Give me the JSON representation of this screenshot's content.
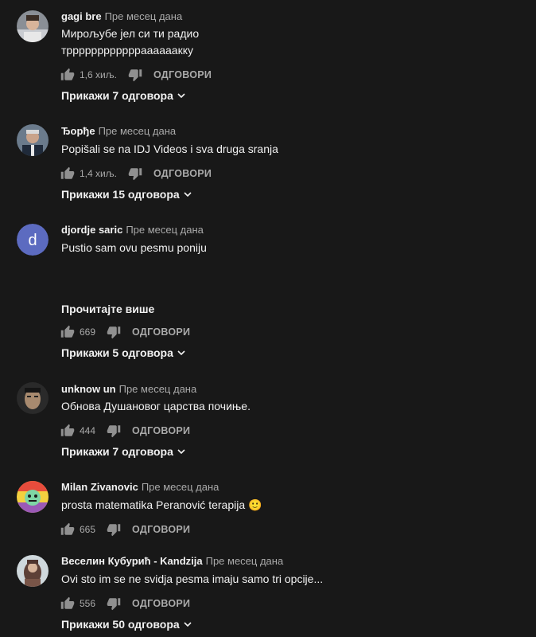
{
  "comments": [
    {
      "author": "gagi bre",
      "time": "Пре месец дана",
      "text_lines": [
        "Мирољубе јел си ти радио",
        "трррррррррррраааааакку"
      ],
      "likes": "1,6 хиљ.",
      "reply_label": "ОДГОВОРИ",
      "replies_label": "Прикажи 7 одговора"
    },
    {
      "author": "Ђорђе",
      "time": "Пре месец дана",
      "text_lines": [
        "Popišali se na IDJ Videos i sva druga sranja"
      ],
      "likes": "1,4 хиљ.",
      "reply_label": "ОДГОВОРИ",
      "replies_label": "Прикажи 15 одговора"
    },
    {
      "author": "djordje saric",
      "time": "Пре месец дана",
      "avatar_letter": "d",
      "avatar_color": "#5c6bc0",
      "text_lines": [
        "Pustio sam ovu pesmu poniju"
      ],
      "read_more": "Прочитајте више",
      "likes": "669",
      "reply_label": "ОДГОВОРИ",
      "replies_label": "Прикажи 5 одговора"
    },
    {
      "author": "unknow un",
      "time": "Пре месец дана",
      "text_lines": [
        "Обнова Душановог царства почиње."
      ],
      "likes": "444",
      "reply_label": "ОДГОВОРИ",
      "replies_label": "Прикажи 7 одговора"
    },
    {
      "author": "Milan Zivanovic",
      "time": "Пре месец дана",
      "text_lines": [
        "prosta matematika Peranović terapija 🙂"
      ],
      "likes": "665",
      "reply_label": "ОДГОВОРИ"
    },
    {
      "author": "Веселин Кубурић - Kandzija",
      "time": "Пре месец дана",
      "text_lines": [
        "Ovi sto im se ne svidja pesma imaju samo tri opcije..."
      ],
      "likes": "556",
      "reply_label": "ОДГОВОРИ",
      "replies_label": "Прикажи 50 одговора"
    }
  ],
  "icons": {
    "like": "thumb-up-icon",
    "dislike": "thumb-down-icon",
    "expand": "chevron-down-icon"
  }
}
